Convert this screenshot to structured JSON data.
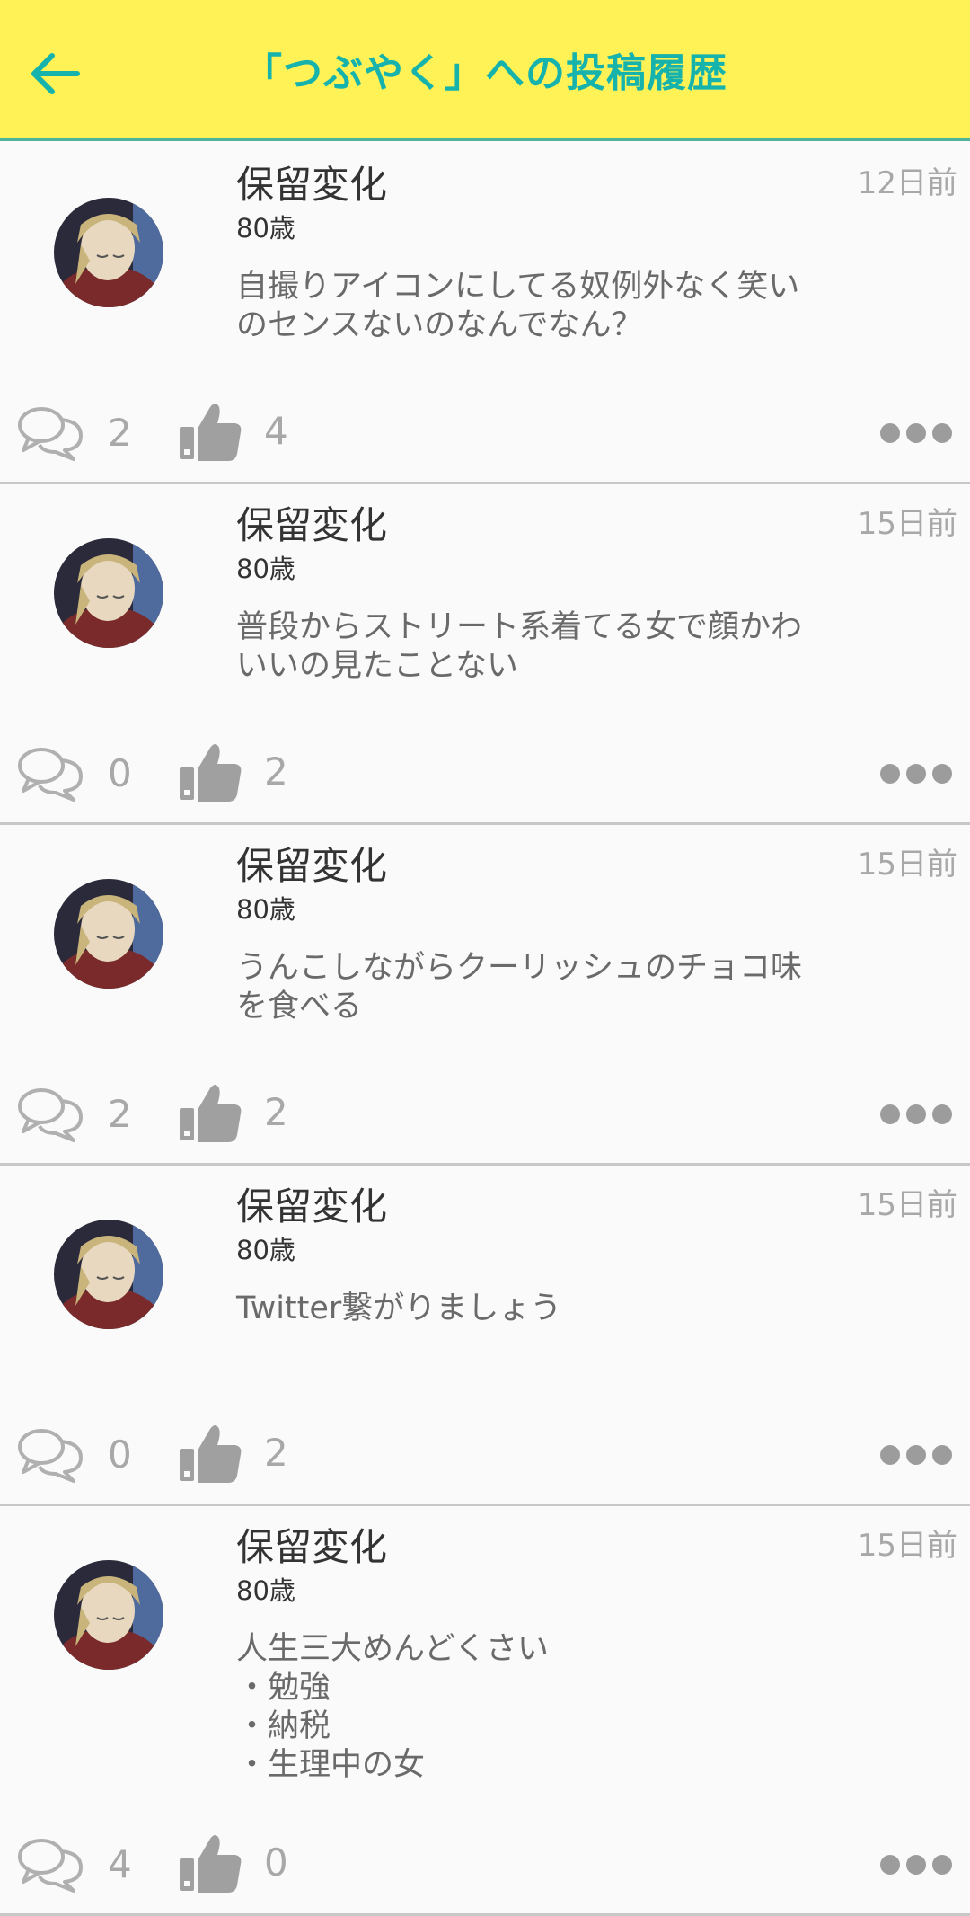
{
  "header": {
    "title": "「つぶやく」への投稿履歴",
    "back_icon": "arrow-left-icon",
    "accent_color": "#16b3ad",
    "background_color": "#fff256"
  },
  "posts": [
    {
      "username": "保留変化",
      "age": "80歳",
      "time": "12日前",
      "text": "自撮りアイコンにしてる奴例外なく笑い\nのセンスないのなんでなん？",
      "comments": "2",
      "likes": "4"
    },
    {
      "username": "保留変化",
      "age": "80歳",
      "time": "15日前",
      "text": "普段からストリート系着てる女で顔かわ\nいいの見たことない",
      "comments": "0",
      "likes": "2"
    },
    {
      "username": "保留変化",
      "age": "80歳",
      "time": "15日前",
      "text": "うんこしながらクーリッシュのチョコ味\nを食べる",
      "comments": "2",
      "likes": "2"
    },
    {
      "username": "保留変化",
      "age": "80歳",
      "time": "15日前",
      "text": "Twitter繋がりましょう",
      "comments": "0",
      "likes": "2"
    },
    {
      "username": "保留変化",
      "age": "80歳",
      "time": "15日前",
      "text": "人生三大めんどくさい\n・勉強\n・納税\n・生理中の女",
      "comments": "4",
      "likes": "0"
    }
  ]
}
